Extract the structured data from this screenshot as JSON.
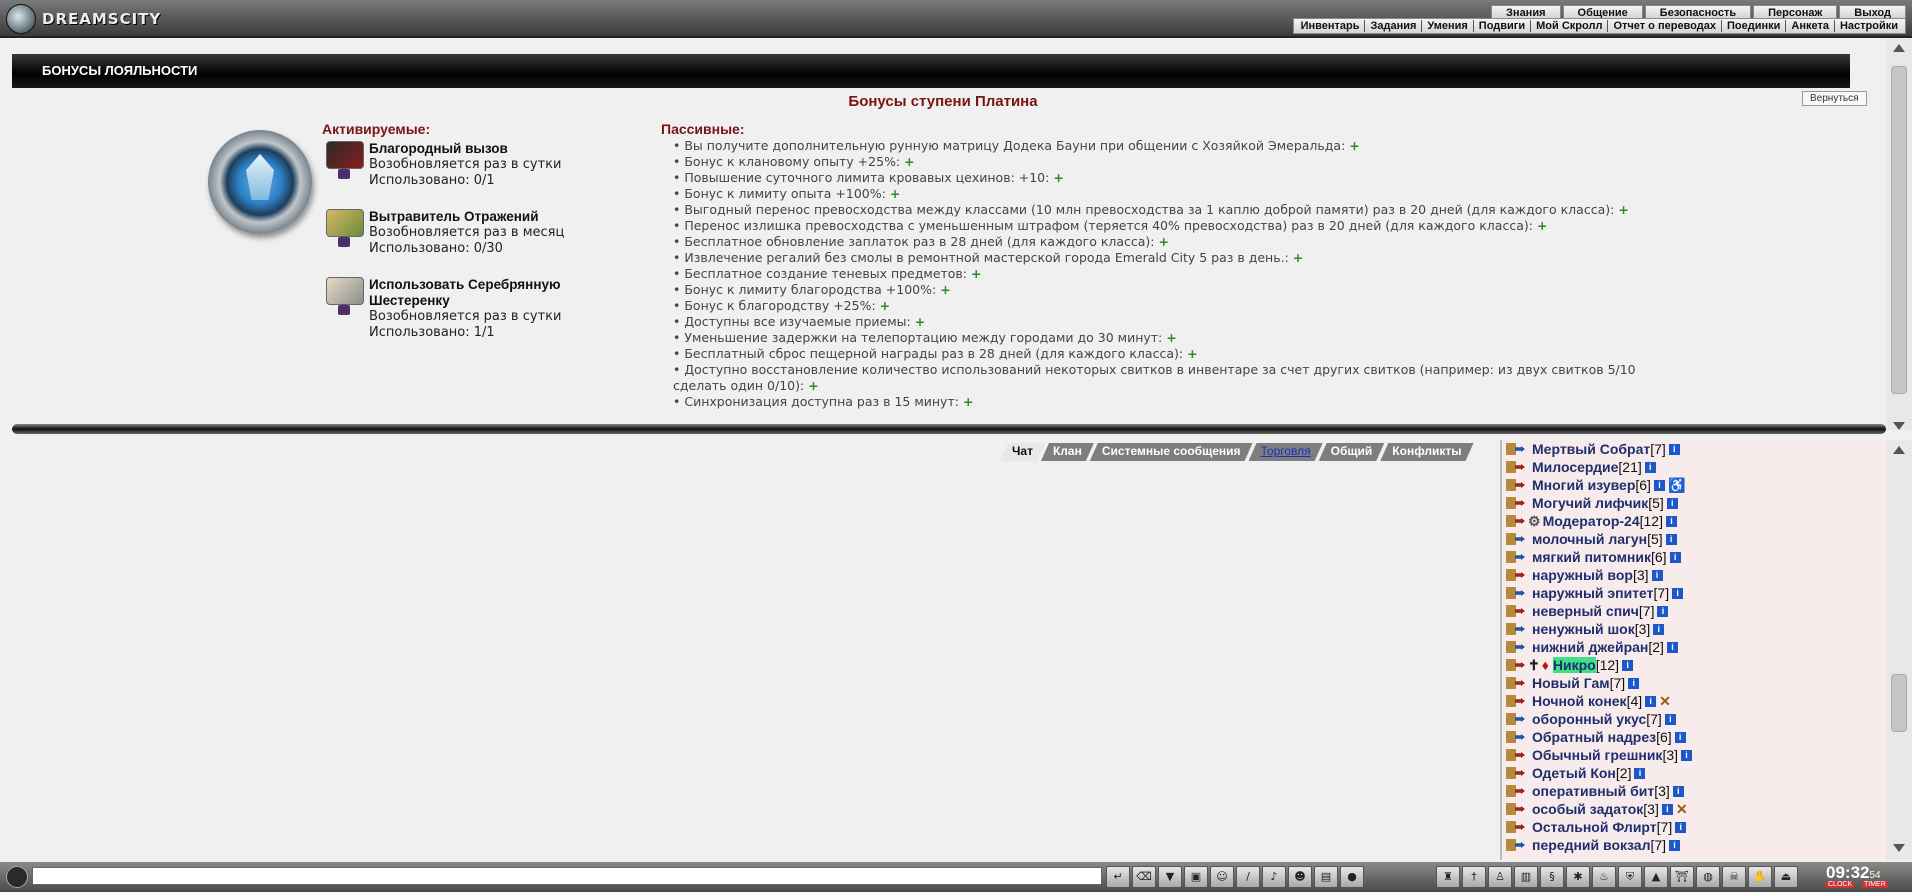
{
  "brand": "DREAMSCITY",
  "top_menu": [
    "Знания",
    "Общение",
    "Безопасность",
    "Персонаж",
    "Выход"
  ],
  "sub_menu": [
    "Инвентарь",
    "Задания",
    "Умения",
    "Подвиги",
    "Мой Скролл",
    "Отчет о переводах",
    "Поединки",
    "Анкета",
    "Настройки"
  ],
  "page": {
    "header": "БОНУСЫ ЛОЯЛЬНОСТИ",
    "tier_title": "Бонусы ступени Платина",
    "back_label": "Вернуться",
    "active_title": "Активируемые:",
    "passive_title": "Пассивные:"
  },
  "active_bonuses": [
    {
      "name": "Благородный вызов",
      "renew": "Возобновляется раз в сутки",
      "used": "Использовано: 0/1",
      "icon": "scroll-red-icon"
    },
    {
      "name": "Вытравитель Отражений",
      "renew": "Возобновляется раз в месяц",
      "used": "Использовано: 0/30",
      "icon": "scroll-gold-icon"
    },
    {
      "name": "Использовать Серебрянную Шестеренку",
      "renew": "Возобновляется раз в сутки",
      "used": "Использовано: 1/1",
      "icon": "scroll-gear-icon"
    }
  ],
  "passive_bonuses": [
    "• Вы получите дополнительную рунную матрицу Додека Бауни при общении с Хозяйкой Эмеральда:",
    "• Бонус к клановому опыту +25%:",
    "• Повышение суточного лимита кровавых цехинов: +10:",
    "• Бонус к лимиту опыта +100%:",
    "• Выгодный перенос превосходства между классами (10 млн превосходства за 1 каплю доброй памяти) раз в 20 дней (для каждого класса):",
    "• Перенос излишка превосходства с уменьшенным штрафом (теряется 40% превосходства) раз в 20 дней (для каждого класса):",
    "• Бесплатное обновление заплаток раз в 28 дней (для каждого класса):",
    "• Извлечение регалий без смолы в ремонтной мастерской города Emerald City 5 раз в день.:",
    "• Бесплатное создание теневых предметов:",
    "• Бонус к лимиту благородства +100%:",
    "• Бонус к благородству +25%:",
    "• Доступны все изучаемые приемы:",
    "• Уменьшение задержки на телепортацию между городами до 30 минут:",
    "• Бесплатный сброс пещерной награды раз в 28 дней (для каждого класса):",
    "• Доступно восстановление количество использований некоторых свитков в инвентаре за счет других свитков (например: из двух свитков 5/10",
    "сделать один 0/10):",
    "• Синхронизация доступна раз в 15 минут:"
  ],
  "plus_sign": "+",
  "chat_tabs": [
    "Чат",
    "Клан",
    "Системные сообщения",
    "Торговля",
    "Общий",
    "Конфликты"
  ],
  "users": [
    {
      "name": "Мертвый Собрат",
      "level": "[7]",
      "dir": "blue"
    },
    {
      "name": "Милосердие",
      "level": "[21]",
      "dir": "red"
    },
    {
      "name": "Многий изувер",
      "level": "[6]",
      "dir": "red"
    },
    {
      "name": "Могучий лифчик",
      "level": "[5]",
      "dir": "red"
    },
    {
      "name": "Модератор-24",
      "level": "[12]",
      "dir": "red"
    },
    {
      "name": "молочный лагун",
      "level": "[5]",
      "dir": "blue"
    },
    {
      "name": "мягкий питомник",
      "level": "[6]",
      "dir": "blue"
    },
    {
      "name": "наружный вор",
      "level": "[3]",
      "dir": "red"
    },
    {
      "name": "наружный эпитет",
      "level": "[7]",
      "dir": "blue"
    },
    {
      "name": "неверный спич",
      "level": "[7]",
      "dir": "red"
    },
    {
      "name": "ненужный шок",
      "level": "[3]",
      "dir": "blue"
    },
    {
      "name": "нижний джейран",
      "level": "[2]",
      "dir": "blue"
    },
    {
      "name": "Никро",
      "level": "[12]",
      "dir": "red"
    },
    {
      "name": "Новый Гам",
      "level": "[7]",
      "dir": "red"
    },
    {
      "name": "Ночной конек",
      "level": "[4]",
      "dir": "red"
    },
    {
      "name": "оборонный укус",
      "level": "[7]",
      "dir": "blue"
    },
    {
      "name": "Обратный надрез",
      "level": "[6]",
      "dir": "blue"
    },
    {
      "name": "Обычный грешник",
      "level": "[3]",
      "dir": "red"
    },
    {
      "name": "Одетый Кон",
      "level": "[2]",
      "dir": "red"
    },
    {
      "name": "оперативный бит",
      "level": "[3]",
      "dir": "red"
    },
    {
      "name": "особый задаток",
      "level": "[3]",
      "dir": "red"
    },
    {
      "name": "Остальной Флирт",
      "level": "[7]",
      "dir": "red"
    },
    {
      "name": "передний вокзал",
      "level": "[7]",
      "dir": "blue"
    }
  ],
  "clock": {
    "time": "09:32",
    "seconds": "54",
    "label1": "CLOCK",
    "label2": "TIMER"
  }
}
